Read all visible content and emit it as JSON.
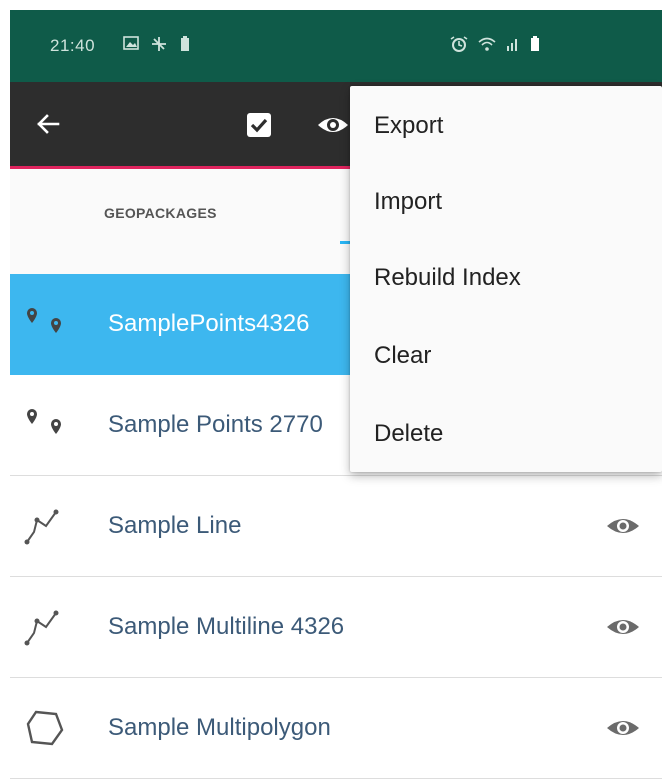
{
  "status_bar": {
    "time": "21:40",
    "left_icons": [
      "image-icon",
      "sync-icon",
      "battery-saver-icon"
    ],
    "right_icons": [
      "alarm-icon",
      "wifi-icon",
      "signal-icon",
      "battery-icon"
    ]
  },
  "toolbar": {
    "background": "#2d2d2d",
    "accent": "#e0245e",
    "back_icon": "back-arrow-icon",
    "select_icon": "checkbox-icon",
    "visibility_icon": "eye-icon"
  },
  "tabs": {
    "items": [
      {
        "label": "GEOPACKAGES"
      }
    ],
    "indicator_color": "#29b6f6"
  },
  "list": {
    "items": [
      {
        "label": "SamplePoints4326",
        "icon": "points-icon",
        "selected": true
      },
      {
        "label": "Sample Points 2770",
        "icon": "points-icon",
        "selected": false
      },
      {
        "label": "Sample Line",
        "icon": "line-icon",
        "selected": false
      },
      {
        "label": "Sample Multiline 4326",
        "icon": "line-icon",
        "selected": false
      },
      {
        "label": "Sample Multipolygon",
        "icon": "polygon-icon",
        "selected": false
      }
    ],
    "selected_color": "#3db7ef",
    "label_color": "#3c5a78"
  },
  "menu": {
    "items": [
      {
        "label": "Export"
      },
      {
        "label": "Import"
      },
      {
        "label": "Rebuild Index"
      },
      {
        "label": "Clear"
      },
      {
        "label": "Delete"
      }
    ]
  }
}
